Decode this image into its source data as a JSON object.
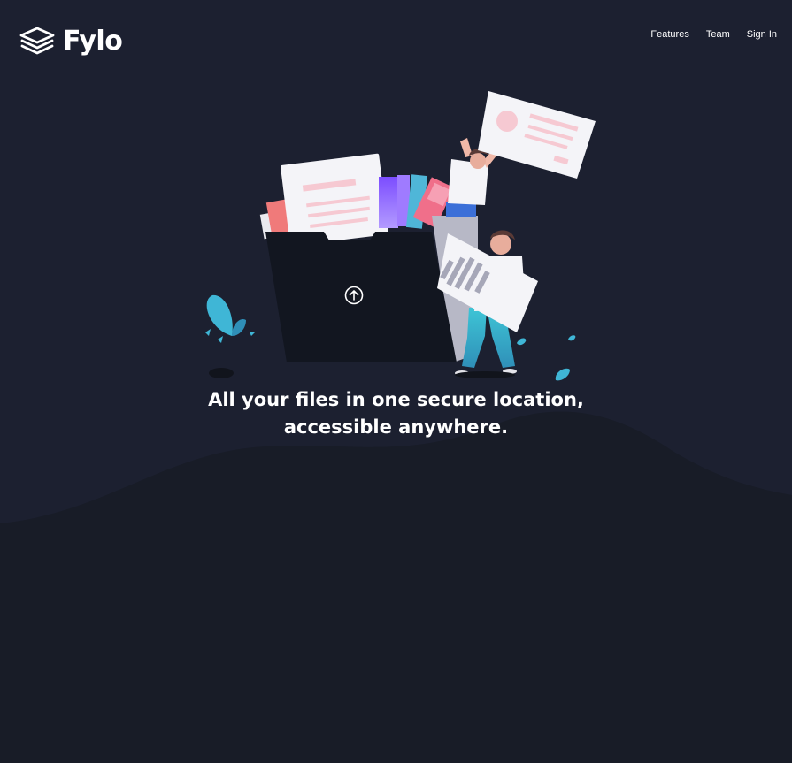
{
  "brand": {
    "name": "Fylo",
    "logo_icon": "stacked-layers-icon"
  },
  "nav": {
    "items": [
      {
        "label": "Features"
      },
      {
        "label": "Team"
      },
      {
        "label": "Sign In"
      }
    ]
  },
  "hero": {
    "title_line1": "All your files in one secure location,",
    "title_line2": "accessible anywhere.",
    "upload_icon": "upload-arrow-icon"
  },
  "colors": {
    "background": "#1c2030",
    "background_lower": "#181c26",
    "text": "#ffffff",
    "accent_cyan": "#3ec5d6",
    "accent_pink": "#f06f8a",
    "accent_purple": "#7c4dff"
  }
}
